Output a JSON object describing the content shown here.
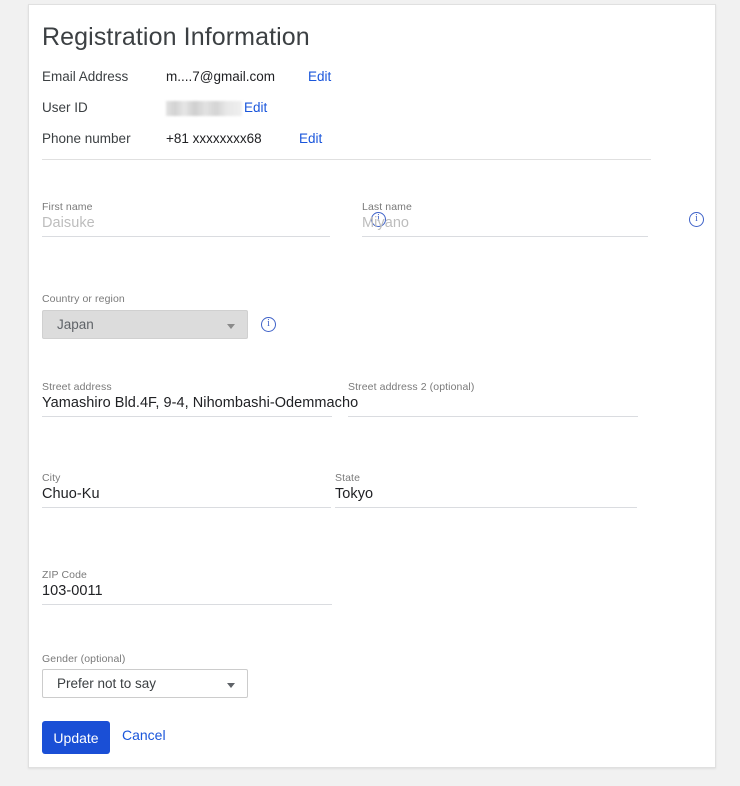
{
  "page": {
    "title": "Registration Information"
  },
  "account_info": {
    "rows": [
      {
        "label": "Email Address",
        "value": "m....7@gmail.com",
        "edit": "Edit",
        "redacted": false
      },
      {
        "label": "User ID",
        "value": "",
        "edit": "Edit",
        "redacted": true
      },
      {
        "label": "Phone number",
        "value": "+81 xxxxxxxx68",
        "edit": "Edit",
        "redacted": false
      }
    ]
  },
  "form": {
    "first_name": {
      "label": "First name",
      "value": "Daisuke",
      "disabled": true
    },
    "last_name": {
      "label": "Last name",
      "value": "Miyano",
      "disabled": true
    },
    "country": {
      "label": "Country or region",
      "value": "Japan",
      "disabled": true
    },
    "street_address": {
      "label": "Street address",
      "value": "Yamashiro Bld.4F, 9-4, Nihombashi-Odemmacho"
    },
    "street_address_2": {
      "label": "Street address 2 (optional)",
      "value": ""
    },
    "city": {
      "label": "City",
      "value": "Chuo-Ku"
    },
    "state": {
      "label": "State",
      "value": "Tokyo"
    },
    "zip_code": {
      "label": "ZIP Code",
      "value": "103-0011"
    },
    "gender": {
      "label": "Gender (optional)",
      "value": "Prefer not to say",
      "disabled": false
    }
  },
  "icons": {
    "info": "i",
    "info_icon_name": "info-icon",
    "dropdown_icon_name": "chevron-down-icon"
  },
  "actions": {
    "update_label": "Update",
    "cancel_label": "Cancel"
  },
  "colors": {
    "accent_blue": "#1a4fd6",
    "link_blue": "#1a56db",
    "info_icon_blue": "#3f62c8",
    "page_background": "#f1f1f1",
    "card_background": "#ffffff",
    "disabled_text": "#bdbdbd",
    "disabled_select_background": "#dcdcdc"
  }
}
